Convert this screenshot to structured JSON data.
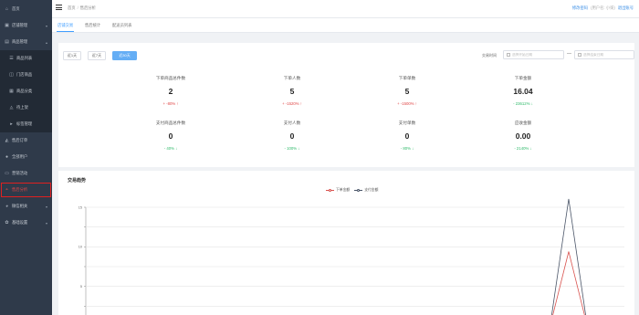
{
  "sidebar": {
    "items": [
      {
        "label": "首页",
        "icon": "home-icon",
        "glyph": "⌂"
      },
      {
        "label": "店铺管理",
        "icon": "store-icon",
        "glyph": "▣",
        "caret": "▾"
      },
      {
        "label": "商品管理",
        "icon": "goods-icon",
        "glyph": "▤",
        "caret": "▴"
      },
      {
        "label": "商品列表",
        "icon": "list-icon",
        "glyph": "☰",
        "sub": true
      },
      {
        "label": "门店商品",
        "icon": "shop-goods-icon",
        "glyph": "◫",
        "sub": true
      },
      {
        "label": "商品分类",
        "icon": "category-icon",
        "glyph": "▦",
        "sub": true
      },
      {
        "label": "待上架",
        "icon": "shelf-icon",
        "glyph": "◬",
        "sub": true
      },
      {
        "label": "标签管理",
        "icon": "tag-icon",
        "glyph": "▸",
        "sub": true
      },
      {
        "label": "售后订单",
        "icon": "aftersale-icon",
        "glyph": "◭"
      },
      {
        "label": "全部用户",
        "icon": "user-icon",
        "glyph": "●"
      },
      {
        "label": "营销活动",
        "icon": "marketing-icon",
        "glyph": "▭"
      },
      {
        "label": "售后分析",
        "icon": "analysis-icon",
        "glyph": "◓",
        "active": true
      },
      {
        "label": "微信相关",
        "icon": "wechat-icon",
        "glyph": "◕",
        "caret": "▾"
      },
      {
        "label": "基础设置",
        "icon": "settings-icon",
        "glyph": "✿",
        "caret": "▾"
      }
    ]
  },
  "topbar": {
    "breadcrumb": [
      "首页",
      "售后分析"
    ],
    "breadcrumb_sep": "/",
    "right_link1": "修改密码",
    "right_muted": "(用户名: 小柒)",
    "right_link2": "退出账号"
  },
  "tabs": [
    {
      "label": "店铺交易",
      "active": true
    },
    {
      "label": "售后统计"
    },
    {
      "label": "配送员列表"
    }
  ],
  "filters": {
    "ranges": [
      "近1天",
      "近7天",
      "近30天"
    ],
    "active_range": 2,
    "date_label": "交易时间",
    "start_placeholder": "选择开始日期",
    "end_placeholder": "选择结束日期",
    "range_sep": "—"
  },
  "stats": [
    {
      "label": "下单商品总件数",
      "value": "2",
      "change": "+ -80% ↑",
      "trend": "up"
    },
    {
      "label": "下单人数",
      "value": "5",
      "change": "+ -1520% ↑",
      "trend": "up"
    },
    {
      "label": "下单单数",
      "value": "5",
      "change": "+ -1500% ↑",
      "trend": "up"
    },
    {
      "label": "下单金额",
      "value": "16.04",
      "change": "- 23612% ↓",
      "trend": "down"
    },
    {
      "label": "支付商品总件数",
      "value": "0",
      "change": "- 40% ↓",
      "trend": "down"
    },
    {
      "label": "支付人数",
      "value": "0",
      "change": "- 100% ↓",
      "trend": "down"
    },
    {
      "label": "支付单数",
      "value": "0",
      "change": "- 80% ↓",
      "trend": "down"
    },
    {
      "label": "应收金额",
      "value": "0.00",
      "change": "- 2140% ↓",
      "trend": "down"
    }
  ],
  "chart_title": "交易趋势",
  "chart_data": {
    "type": "line",
    "title": "",
    "yticks": [
      0,
      2.5,
      5,
      7.5,
      10,
      12.5,
      15
    ],
    "ytick_labels": [
      "",
      "",
      "5",
      "",
      "10",
      "",
      "15"
    ],
    "ylim": [
      0,
      15
    ],
    "n_points": 30,
    "grid": true,
    "legend": "top-center",
    "series": [
      {
        "name": "下单金额",
        "color": "#d9534f",
        "peak_index": 26,
        "peak_value": 9.4
      },
      {
        "name": "支付金额",
        "color": "#4a5568",
        "peak_index": 26,
        "peak_value": 16.04
      }
    ]
  }
}
